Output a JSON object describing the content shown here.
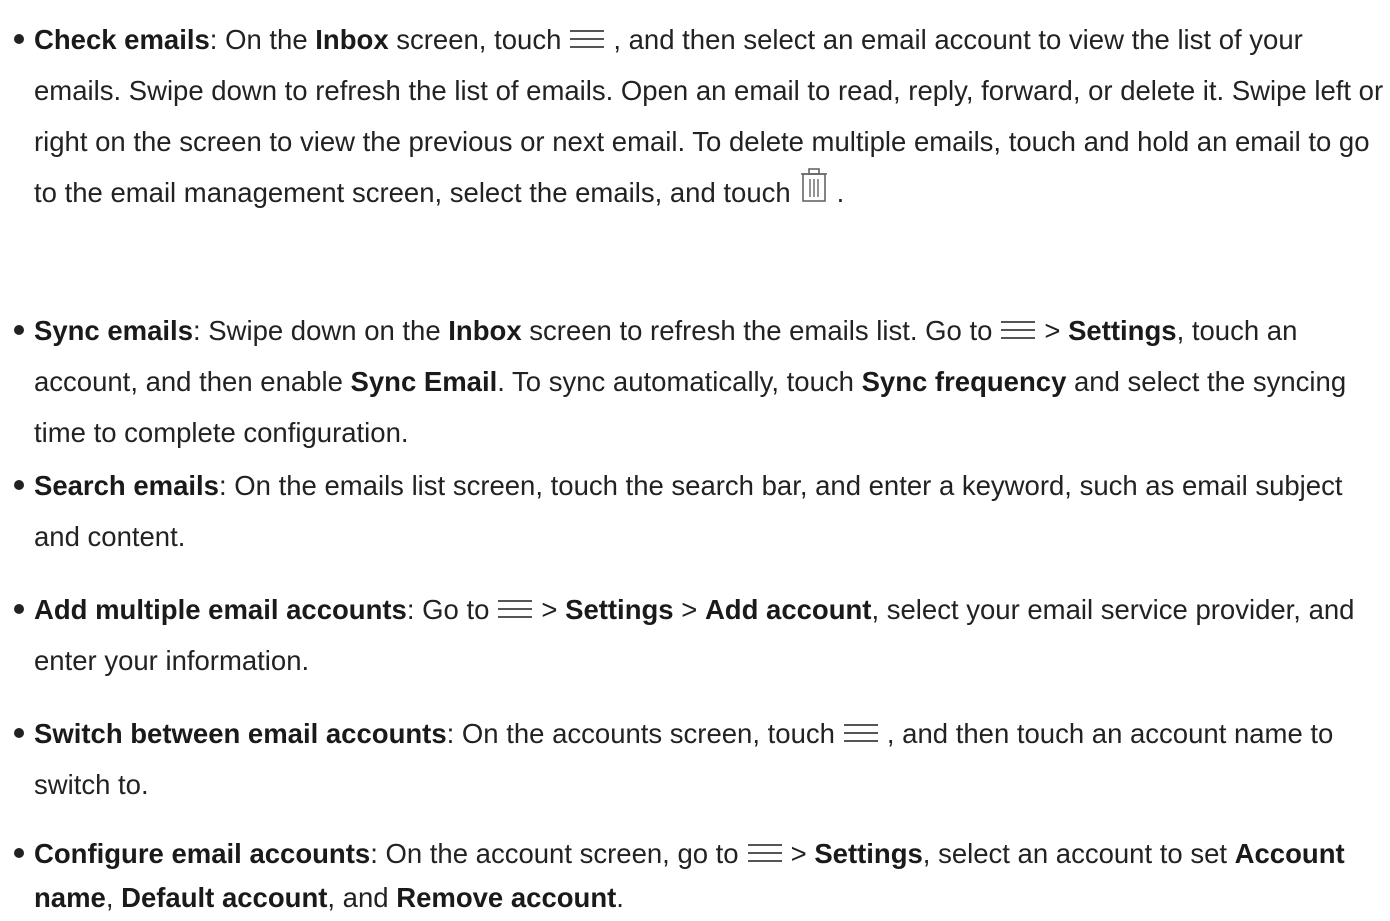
{
  "icons": {
    "menu": "menu-icon",
    "trash": "trash-icon"
  },
  "items": [
    {
      "title": "Check emails",
      "p1": ": On the ",
      "b1": "Inbox",
      "p2": " screen, touch",
      "p3": ", and then select an email account to view the list of your emails. Swipe down to refresh the list of emails. Open an email to read, reply, forward, or delete it. Swipe left or right on the screen to view the previous or next email. To delete multiple emails, touch and hold an email to go to the email management screen, select the emails, and touch",
      "p4": "."
    },
    {
      "title": "Sync emails",
      "p1": ": Swipe down on the ",
      "b1": "Inbox",
      "p2": " screen to refresh the emails list. Go to",
      "p3": "> ",
      "b2": "Settings",
      "p4": ", touch an account, and then enable ",
      "b3": "Sync Email",
      "p5": ". To sync automatically, touch ",
      "b4": "Sync frequency",
      "p6": " and select the syncing time to complete configuration."
    },
    {
      "title": "Search emails",
      "p1": ": On the emails list screen, touch the search bar, and enter a keyword, such as email subject and content."
    },
    {
      "title": "Add multiple email accounts",
      "p1": ": Go to",
      "p2": "> ",
      "b1": "Settings",
      "p3": " > ",
      "b2": "Add account",
      "p4": ", select your email service provider, and enter your information."
    },
    {
      "title": "Switch between email accounts",
      "p1": ": On the accounts screen, touch",
      "p2": ", and then touch an account name to switch to."
    },
    {
      "title": "Configure email accounts",
      "p1": ": On the account screen, go to",
      "p2": "> ",
      "b1": "Settings",
      "p3": ", select an account to set ",
      "b2": "Account name",
      "p4": ", ",
      "b3": "Default account",
      "p5": ", and ",
      "b4": "Remove account",
      "p6": "."
    }
  ]
}
